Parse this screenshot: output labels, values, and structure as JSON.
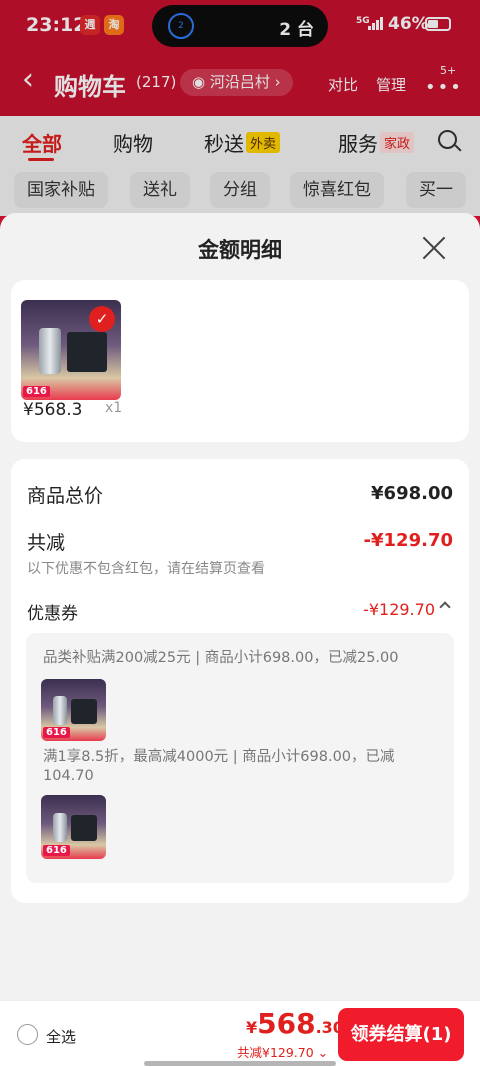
{
  "status_bar": {
    "time": "23:12",
    "app_badge_1": "週",
    "app_badge_2": "淘",
    "island_icon": "2",
    "island_text": "2 台",
    "network": "5G",
    "battery_pct": "46%"
  },
  "header": {
    "title": "购物车",
    "count": "(217)",
    "location": "河沿吕村",
    "compare": "对比",
    "manage": "管理",
    "more_badge": "5+"
  },
  "tabs": {
    "all": "全部",
    "shopping": "购物",
    "express": "秒送",
    "express_tag": "外卖",
    "service": "服务",
    "service_tag": "家政"
  },
  "chips": [
    "国家补贴",
    "送礼",
    "分组",
    "惊喜红包",
    "买一"
  ],
  "sheet": {
    "title": "金额明细",
    "product": {
      "price": "¥568.3",
      "qty": "x1",
      "img_tag": "616"
    },
    "total_label": "商品总价",
    "total_value": "¥698.00",
    "reduce_label": "共减",
    "reduce_value": "-¥129.70",
    "note": "以下优惠不包含红包，请在结算页查看",
    "coupon_label": "优惠券",
    "coupon_value": "-¥129.70",
    "discounts": [
      {
        "text": "品类补贴满200减25元 | 商品小计698.00，已减25.00",
        "img_tag": "616"
      },
      {
        "text": "满1享8.5折，最高减4000元 | 商品小计698.00，已减104.70",
        "img_tag": "616"
      }
    ]
  },
  "bottom_bar": {
    "select_all": "全选",
    "yen": "¥",
    "total_int": "568",
    "total_dec": ".30",
    "saved": "共减¥129.70",
    "checkout": "领券结算(1)"
  }
}
